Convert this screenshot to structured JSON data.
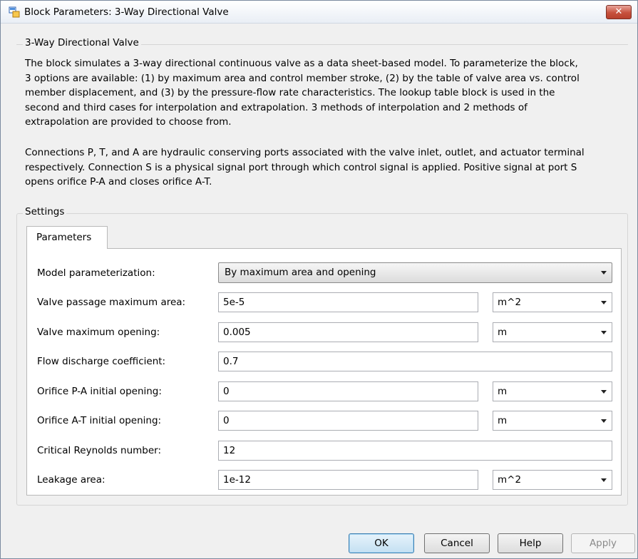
{
  "window": {
    "title": "Block Parameters: 3-Way Directional Valve",
    "close_label": "✕"
  },
  "description": {
    "group_title": "3-Way Directional Valve",
    "paragraph1_lines": [
      "The block simulates a 3-way directional continuous valve as a data sheet-based model. To parameterize the block,",
      "3 options are available: (1) by maximum area and control member stroke, (2) by the table of valve area vs. control",
      "member displacement, and (3) by the pressure-flow rate characteristics. The lookup table block is used in the",
      "second and third cases for interpolation and extrapolation. 3 methods of interpolation and 2 methods of",
      "extrapolation are provided to choose from."
    ],
    "paragraph2_lines": [
      "Connections P, T, and A are hydraulic conserving ports associated with the valve inlet, outlet, and actuator terminal",
      "respectively. Connection S is a physical signal port through which control signal is applied. Positive signal at port S",
      "opens orifice P-A and closes orifice A-T."
    ]
  },
  "settings": {
    "group_title": "Settings",
    "tab_label": "Parameters",
    "model_parameterization": {
      "label": "Model parameterization:",
      "value": "By maximum area and opening"
    },
    "params": [
      {
        "label": "Valve passage maximum area:",
        "value": "5e-5",
        "unit": "m^2"
      },
      {
        "label": "Valve maximum opening:",
        "value": "0.005",
        "unit": "m"
      },
      {
        "label": "Flow discharge coefficient:",
        "value": "0.7"
      },
      {
        "label": "Orifice P-A initial opening:",
        "value": "0",
        "unit": "m"
      },
      {
        "label": "Orifice A-T initial opening:",
        "value": "0",
        "unit": "m"
      },
      {
        "label": "Critical Reynolds number:",
        "value": "12"
      },
      {
        "label": "Leakage area:",
        "value": "1e-12",
        "unit": "m^2"
      }
    ]
  },
  "buttons": {
    "ok": "OK",
    "cancel": "Cancel",
    "help": "Help",
    "apply": "Apply"
  }
}
